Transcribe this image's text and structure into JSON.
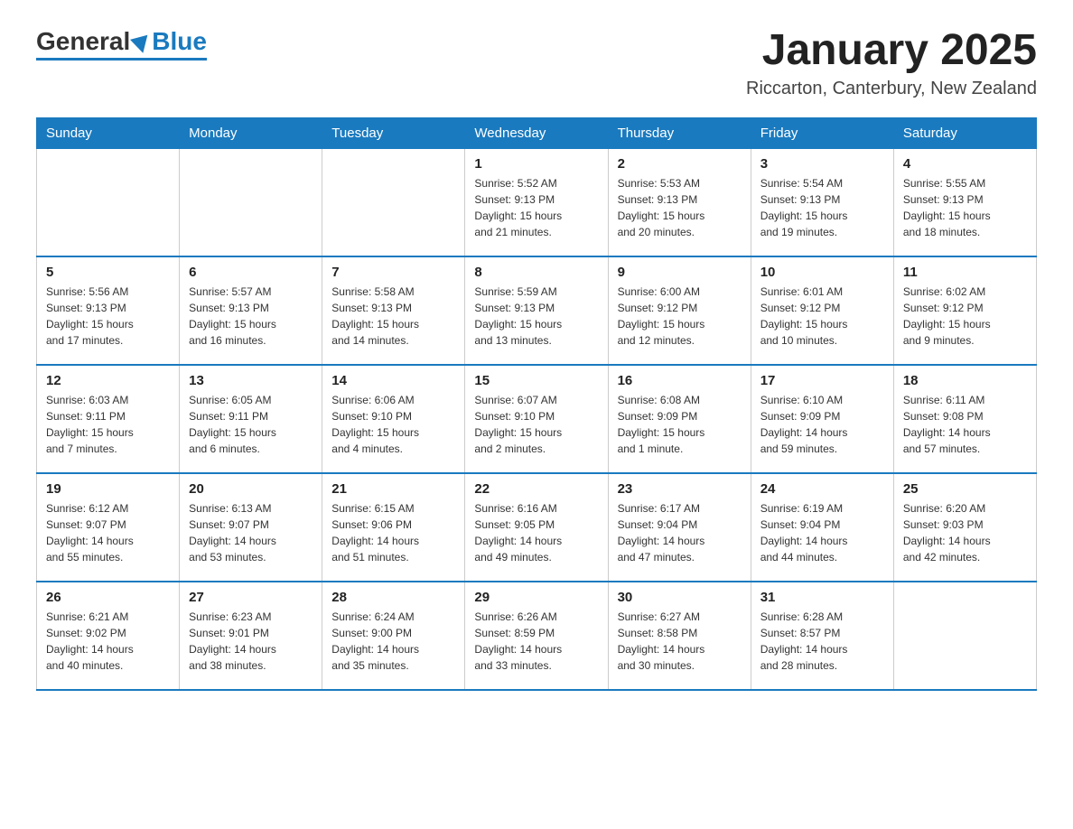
{
  "header": {
    "logo_general": "General",
    "logo_blue": "Blue",
    "month_title": "January 2025",
    "location": "Riccarton, Canterbury, New Zealand"
  },
  "days_of_week": [
    "Sunday",
    "Monday",
    "Tuesday",
    "Wednesday",
    "Thursday",
    "Friday",
    "Saturday"
  ],
  "weeks": [
    [
      {
        "day": "",
        "info": ""
      },
      {
        "day": "",
        "info": ""
      },
      {
        "day": "",
        "info": ""
      },
      {
        "day": "1",
        "info": "Sunrise: 5:52 AM\nSunset: 9:13 PM\nDaylight: 15 hours\nand 21 minutes."
      },
      {
        "day": "2",
        "info": "Sunrise: 5:53 AM\nSunset: 9:13 PM\nDaylight: 15 hours\nand 20 minutes."
      },
      {
        "day": "3",
        "info": "Sunrise: 5:54 AM\nSunset: 9:13 PM\nDaylight: 15 hours\nand 19 minutes."
      },
      {
        "day": "4",
        "info": "Sunrise: 5:55 AM\nSunset: 9:13 PM\nDaylight: 15 hours\nand 18 minutes."
      }
    ],
    [
      {
        "day": "5",
        "info": "Sunrise: 5:56 AM\nSunset: 9:13 PM\nDaylight: 15 hours\nand 17 minutes."
      },
      {
        "day": "6",
        "info": "Sunrise: 5:57 AM\nSunset: 9:13 PM\nDaylight: 15 hours\nand 16 minutes."
      },
      {
        "day": "7",
        "info": "Sunrise: 5:58 AM\nSunset: 9:13 PM\nDaylight: 15 hours\nand 14 minutes."
      },
      {
        "day": "8",
        "info": "Sunrise: 5:59 AM\nSunset: 9:13 PM\nDaylight: 15 hours\nand 13 minutes."
      },
      {
        "day": "9",
        "info": "Sunrise: 6:00 AM\nSunset: 9:12 PM\nDaylight: 15 hours\nand 12 minutes."
      },
      {
        "day": "10",
        "info": "Sunrise: 6:01 AM\nSunset: 9:12 PM\nDaylight: 15 hours\nand 10 minutes."
      },
      {
        "day": "11",
        "info": "Sunrise: 6:02 AM\nSunset: 9:12 PM\nDaylight: 15 hours\nand 9 minutes."
      }
    ],
    [
      {
        "day": "12",
        "info": "Sunrise: 6:03 AM\nSunset: 9:11 PM\nDaylight: 15 hours\nand 7 minutes."
      },
      {
        "day": "13",
        "info": "Sunrise: 6:05 AM\nSunset: 9:11 PM\nDaylight: 15 hours\nand 6 minutes."
      },
      {
        "day": "14",
        "info": "Sunrise: 6:06 AM\nSunset: 9:10 PM\nDaylight: 15 hours\nand 4 minutes."
      },
      {
        "day": "15",
        "info": "Sunrise: 6:07 AM\nSunset: 9:10 PM\nDaylight: 15 hours\nand 2 minutes."
      },
      {
        "day": "16",
        "info": "Sunrise: 6:08 AM\nSunset: 9:09 PM\nDaylight: 15 hours\nand 1 minute."
      },
      {
        "day": "17",
        "info": "Sunrise: 6:10 AM\nSunset: 9:09 PM\nDaylight: 14 hours\nand 59 minutes."
      },
      {
        "day": "18",
        "info": "Sunrise: 6:11 AM\nSunset: 9:08 PM\nDaylight: 14 hours\nand 57 minutes."
      }
    ],
    [
      {
        "day": "19",
        "info": "Sunrise: 6:12 AM\nSunset: 9:07 PM\nDaylight: 14 hours\nand 55 minutes."
      },
      {
        "day": "20",
        "info": "Sunrise: 6:13 AM\nSunset: 9:07 PM\nDaylight: 14 hours\nand 53 minutes."
      },
      {
        "day": "21",
        "info": "Sunrise: 6:15 AM\nSunset: 9:06 PM\nDaylight: 14 hours\nand 51 minutes."
      },
      {
        "day": "22",
        "info": "Sunrise: 6:16 AM\nSunset: 9:05 PM\nDaylight: 14 hours\nand 49 minutes."
      },
      {
        "day": "23",
        "info": "Sunrise: 6:17 AM\nSunset: 9:04 PM\nDaylight: 14 hours\nand 47 minutes."
      },
      {
        "day": "24",
        "info": "Sunrise: 6:19 AM\nSunset: 9:04 PM\nDaylight: 14 hours\nand 44 minutes."
      },
      {
        "day": "25",
        "info": "Sunrise: 6:20 AM\nSunset: 9:03 PM\nDaylight: 14 hours\nand 42 minutes."
      }
    ],
    [
      {
        "day": "26",
        "info": "Sunrise: 6:21 AM\nSunset: 9:02 PM\nDaylight: 14 hours\nand 40 minutes."
      },
      {
        "day": "27",
        "info": "Sunrise: 6:23 AM\nSunset: 9:01 PM\nDaylight: 14 hours\nand 38 minutes."
      },
      {
        "day": "28",
        "info": "Sunrise: 6:24 AM\nSunset: 9:00 PM\nDaylight: 14 hours\nand 35 minutes."
      },
      {
        "day": "29",
        "info": "Sunrise: 6:26 AM\nSunset: 8:59 PM\nDaylight: 14 hours\nand 33 minutes."
      },
      {
        "day": "30",
        "info": "Sunrise: 6:27 AM\nSunset: 8:58 PM\nDaylight: 14 hours\nand 30 minutes."
      },
      {
        "day": "31",
        "info": "Sunrise: 6:28 AM\nSunset: 8:57 PM\nDaylight: 14 hours\nand 28 minutes."
      },
      {
        "day": "",
        "info": ""
      }
    ]
  ]
}
